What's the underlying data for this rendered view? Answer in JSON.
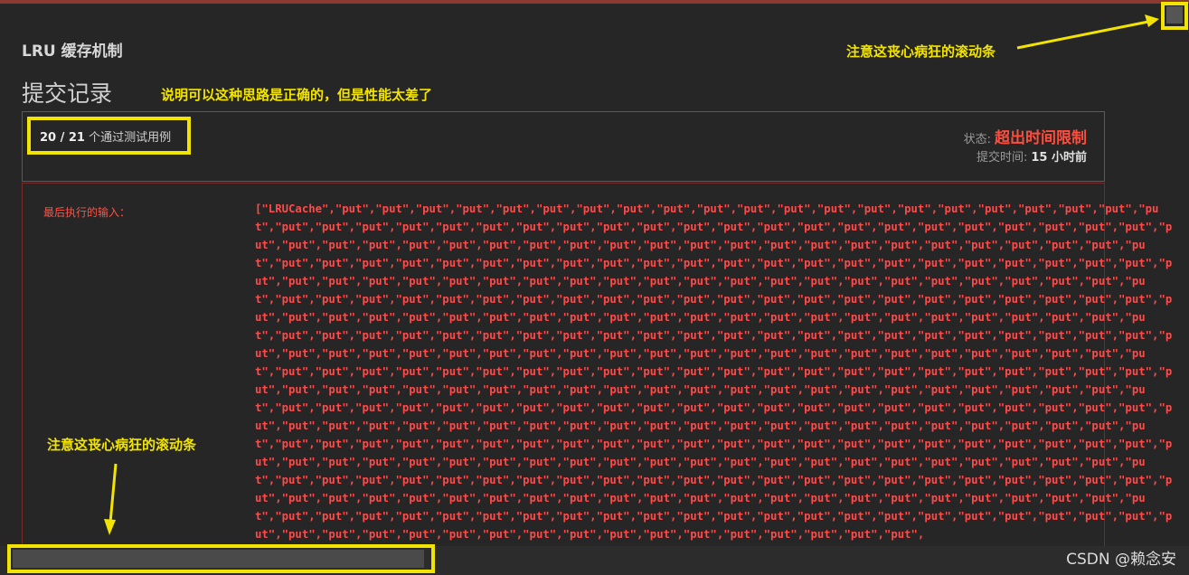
{
  "problem_title": "LRU 缓存机制",
  "section_title": "提交记录",
  "annotations": {
    "top_right": "注意这丧心病狂的滚动条",
    "mid": "说明可以这种思路是正确的，但是性能太差了",
    "bottom_left": "注意这丧心病狂的滚动条"
  },
  "summary": {
    "passed_count": "20 / 21",
    "passed_label": "个通过测试用例",
    "status_label": "状态:",
    "status_value": "超出时间限制",
    "time_label": "提交时间:",
    "time_value": "15 小时前"
  },
  "error": {
    "label": "最后执行的输入：",
    "data_head": "[\"LRUCache\",",
    "data_repeat": "\"put\","
  },
  "watermark": "CSDN @赖念安",
  "colors": {
    "highlight": "#f2e400",
    "error": "#ff4a4a"
  }
}
